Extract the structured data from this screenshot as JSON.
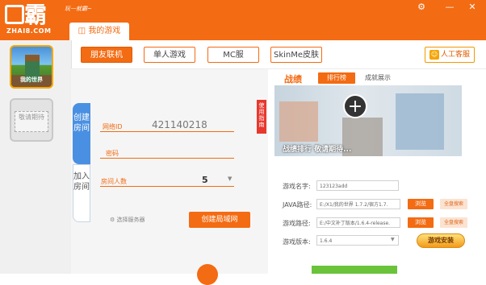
{
  "brand": {
    "logo_text": "霸",
    "site": "ZHAI8.COM",
    "slogan": "玩一就霸~"
  },
  "window_controls": {
    "settings": "⚙",
    "minimize": "—",
    "close": "✕"
  },
  "tabs": {
    "my_games": "我的游戏"
  },
  "sidebar": {
    "items": [
      {
        "label": "我的世界"
      },
      {
        "label": "敬请期待"
      }
    ]
  },
  "mode_buttons": [
    {
      "label": "朋友联机",
      "active": true
    },
    {
      "label": "单人游戏",
      "active": false
    },
    {
      "label": "MC服",
      "active": false
    },
    {
      "label": "SkinMe皮肤",
      "active": false
    }
  ],
  "service": {
    "label": "人工客服"
  },
  "room": {
    "vertical_tabs": {
      "create": "创建房间",
      "join": "加入房间"
    },
    "netid_label": "网络ID",
    "netid_value": "421140218",
    "password_label": "密码",
    "count_label": "房间人数",
    "count_value": "5",
    "select_server": "选择服务器",
    "create_lan": "创建局域网"
  },
  "help_strip": "使用指南",
  "records": {
    "title": "战绩",
    "tab_rank": "排行榜",
    "tab_show": "成就展示",
    "banner_caption": "战绩排行 敬请期待..."
  },
  "form": {
    "game_name": {
      "label": "游戏名字:",
      "value": "123123add"
    },
    "java_path": {
      "label": "JAVA路径:",
      "value": "E:/X1/我的世界 1.7.2/宿方1.7.",
      "browse": "浏览",
      "search": "全盘搜索"
    },
    "game_path": {
      "label": "游戏路径:",
      "value": "E:/中文补丁版本/1.6.4-release.",
      "browse": "浏览",
      "search": "全盘搜索"
    },
    "version": {
      "label": "游戏版本:",
      "value": "1.6.4"
    },
    "install": "游戏安装"
  },
  "colors": {
    "accent": "#f36b12",
    "blue_tab": "#4a90e2",
    "green": "#6ac33a"
  }
}
